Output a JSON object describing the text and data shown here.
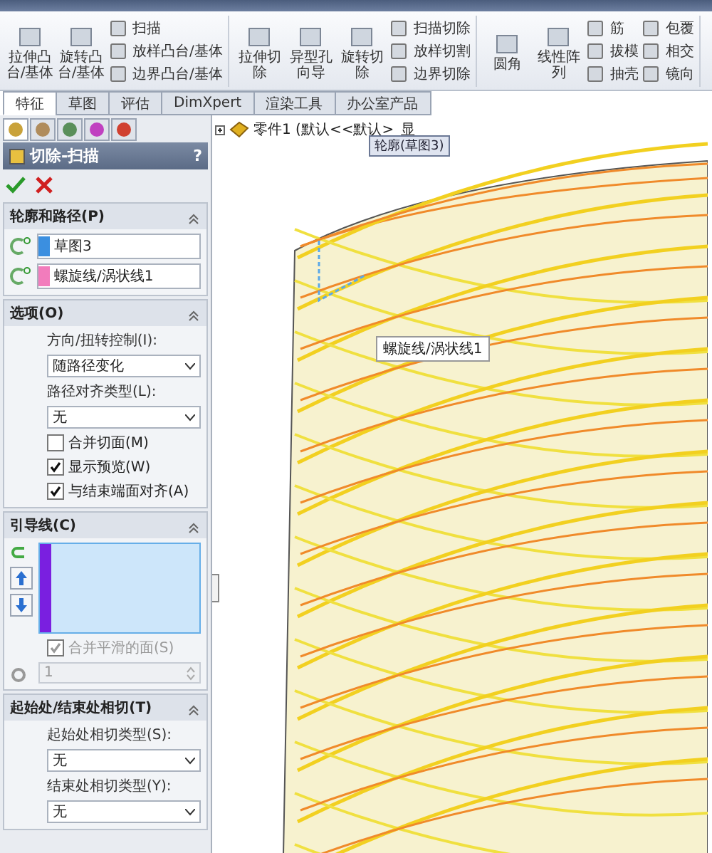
{
  "toolbar": {
    "groups": [
      {
        "large": [
          "拉伸凸台/基体",
          "旋转凸台/基体"
        ],
        "small_columns": [
          [
            "扫描",
            "放样凸台/基体",
            "边界凸台/基体"
          ]
        ]
      },
      {
        "large": [
          "拉伸切除",
          "异型孔向导",
          "旋转切除"
        ],
        "small_columns": [
          [
            "扫描切除",
            "放样切割",
            "边界切除"
          ]
        ]
      },
      {
        "large": [
          "圆角",
          "线性阵列"
        ],
        "small_columns": [
          [
            "筋",
            "拔模",
            "抽壳"
          ],
          [
            "包覆",
            "相交",
            "镜向"
          ]
        ]
      }
    ]
  },
  "tabs": [
    {
      "label": "特征",
      "selected": true
    },
    {
      "label": "草图",
      "selected": false
    },
    {
      "label": "评估",
      "selected": false
    },
    {
      "label": "DimXpert",
      "selected": false
    },
    {
      "label": "渲染工具",
      "selected": false
    },
    {
      "label": "办公室产品",
      "selected": false
    }
  ],
  "panel": {
    "icon_tabs": [
      {
        "selected": true
      },
      {
        "selected": false
      },
      {
        "selected": false
      },
      {
        "selected": false
      },
      {
        "selected": false
      }
    ],
    "title": "切除-扫描",
    "help": "?",
    "sections": [
      {
        "title": "轮廓和路径(P)",
        "rows": [
          {
            "kind": "selection",
            "value": "草图3",
            "color": "#3b8fe0"
          },
          {
            "kind": "selection",
            "value": "螺旋线/涡状线1",
            "color": "#f27cbc"
          }
        ]
      },
      {
        "title": "选项(O)",
        "rows": [
          {
            "kind": "label",
            "text": "方向/扭转控制(I):"
          },
          {
            "kind": "dropdown",
            "value": "随路径变化"
          },
          {
            "kind": "label",
            "text": "路径对齐类型(L):"
          },
          {
            "kind": "dropdown",
            "value": "无"
          },
          {
            "kind": "checkbox",
            "text": "合并切面(M)",
            "checked": false,
            "disabled": false
          },
          {
            "kind": "checkbox",
            "text": "显示预览(W)",
            "checked": true,
            "disabled": false
          },
          {
            "kind": "checkbox",
            "text": "与结束端面对齐(A)",
            "checked": true,
            "disabled": false
          }
        ]
      },
      {
        "title": "引导线(C)",
        "rows": [
          {
            "kind": "guide_list",
            "color": "#7a1fe0"
          },
          {
            "kind": "checkbox",
            "text": "合并平滑的面(S)",
            "checked": true,
            "disabled": true
          },
          {
            "kind": "spinner",
            "value": "1",
            "disabled": true
          }
        ]
      },
      {
        "title": "起始处/结束处相切(T)",
        "rows": [
          {
            "kind": "label",
            "text": "起始处相切类型(S):"
          },
          {
            "kind": "dropdown",
            "value": "无"
          },
          {
            "kind": "label",
            "text": "结束处相切类型(Y):"
          },
          {
            "kind": "dropdown",
            "value": "无"
          }
        ]
      }
    ]
  },
  "viewport": {
    "tree_item": "零件1  (默认<<默认>_显",
    "callouts": [
      "轮廓(草图3)",
      "螺旋线/涡状线1"
    ]
  }
}
